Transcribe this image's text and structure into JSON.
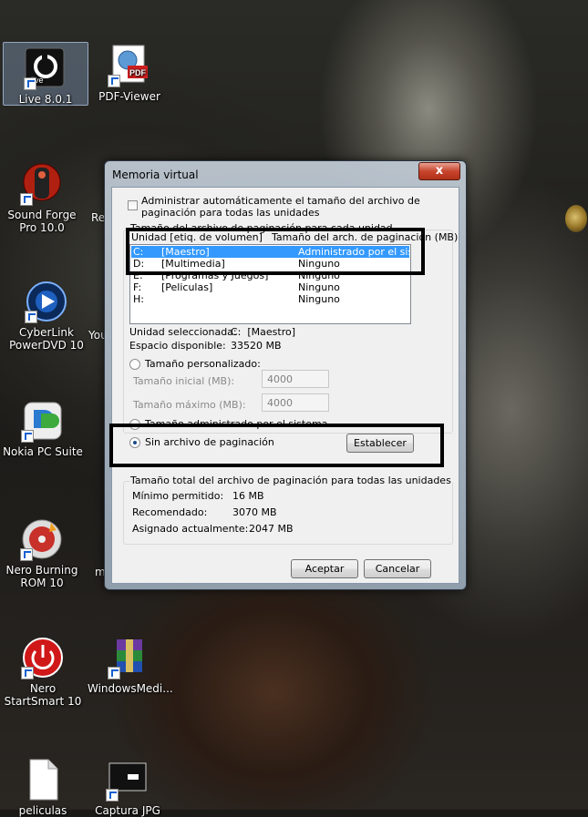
{
  "desktop": {
    "icons": [
      {
        "label": "Live 8.0.1",
        "icon": "ableton-live-icon"
      },
      {
        "label": "PDF-Viewer",
        "icon": "pdf-viewer-icon"
      },
      {
        "label": "Sound Forge Pro 10.0",
        "icon": "sound-forge-icon"
      },
      {
        "label": "CyberLink PowerDVD 10",
        "icon": "powerdvd-icon"
      },
      {
        "label": "Nokia PC Suite",
        "icon": "nokia-pc-suite-icon"
      },
      {
        "label": "Nero Burning ROM 10",
        "icon": "nero-burning-icon"
      },
      {
        "label": "Nero StartSmart 10",
        "icon": "nero-startsmart-icon"
      },
      {
        "label": "WindowsMedi...",
        "icon": "winrar-archive-icon"
      },
      {
        "label": "peliculas",
        "icon": "text-file-icon"
      },
      {
        "label": "Captura JPG",
        "icon": "image-file-icon"
      }
    ],
    "partial_labels": [
      "Re",
      "You",
      "m"
    ]
  },
  "dialog": {
    "title": "Memoria virtual",
    "close_label": "x",
    "auto_manage_label": "Administrar automáticamente el tamaño del archivo de paginación para todas las unidades",
    "auto_manage_checked": false,
    "per_drive_group_label": "Tamaño del archivo de paginación para cada unidad",
    "list_headers": {
      "drive": "Unidad [etiq. de volumen]",
      "size": "Tamaño del arch. de paginación (MB)"
    },
    "drives": [
      {
        "letter": "C:",
        "label": "[Maestro]",
        "size": "Administrado por el sistema",
        "selected": true
      },
      {
        "letter": "D:",
        "label": "[Multimedia]",
        "size": "Ninguno",
        "selected": false
      },
      {
        "letter": "E:",
        "label": "[Programas y Juegos]",
        "size": "Ninguno",
        "selected": false
      },
      {
        "letter": "F:",
        "label": "[Peliculas]",
        "size": "Ninguno",
        "selected": false
      },
      {
        "letter": "H:",
        "label": "",
        "size": "Ninguno",
        "selected": false
      }
    ],
    "selected_drive_label": "Unidad seleccionada:",
    "selected_drive_value": "C:  [Maestro]",
    "available_space_label": "Espacio disponible:",
    "available_space_value": "33520 MB",
    "custom_size_label": "Tamaño personalizado:",
    "initial_size_label": "Tamaño inicial (MB):",
    "initial_size_value": "4000",
    "max_size_label": "Tamaño máximo (MB):",
    "max_size_value": "4000",
    "system_managed_label": "Tamaño administrado por el sistema",
    "no_paging_label": "Sin archivo de paginación",
    "set_button": "Establecer",
    "total_group_label": "Tamaño total del archivo de paginación para todas las unidades",
    "min_allowed_label": "Mínimo permitido:",
    "min_allowed_value": "16 MB",
    "recommended_label": "Recomendado:",
    "recommended_value": "3070 MB",
    "allocated_label": "Asignado actualmente:",
    "allocated_value": "2047 MB",
    "ok_button": "Aceptar",
    "cancel_button": "Cancelar"
  }
}
